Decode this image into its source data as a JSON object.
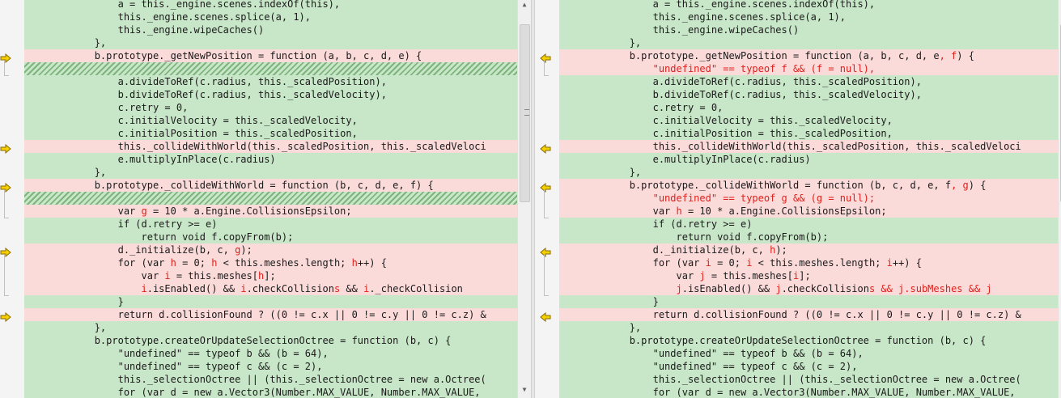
{
  "left": {
    "lines": [
      {
        "t": "same",
        "segs": [
          [
            "",
            "                a = this._engine.scenes.indexOf(this),"
          ]
        ]
      },
      {
        "t": "same",
        "segs": [
          [
            "",
            "                this._engine.scenes.splice(a, 1),"
          ]
        ]
      },
      {
        "t": "same",
        "segs": [
          [
            "",
            "                this._engine.wipeCaches()"
          ]
        ]
      },
      {
        "t": "same",
        "segs": [
          [
            "",
            "            },"
          ]
        ]
      },
      {
        "t": "diff",
        "segs": [
          [
            "",
            "            b.prototype._getNewPosition = function (a, b, c, d, e) {"
          ]
        ]
      },
      {
        "t": "pad",
        "segs": []
      },
      {
        "t": "same",
        "segs": [
          [
            "",
            "                a.divideToRef(c.radius, this._scaledPosition),"
          ]
        ]
      },
      {
        "t": "same",
        "segs": [
          [
            "",
            "                b.divideToRef(c.radius, this._scaledVelocity),"
          ]
        ]
      },
      {
        "t": "same",
        "segs": [
          [
            "",
            "                c.retry = 0,"
          ]
        ]
      },
      {
        "t": "same",
        "segs": [
          [
            "",
            "                c.initialVelocity = this._scaledVelocity,"
          ]
        ]
      },
      {
        "t": "same",
        "segs": [
          [
            "",
            "                c.initialPosition = this._scaledPosition,"
          ]
        ]
      },
      {
        "t": "diff",
        "segs": [
          [
            "",
            "                this._collideWithWorld(this._scaledPosition, this._scaledVeloci"
          ]
        ]
      },
      {
        "t": "same",
        "segs": [
          [
            "",
            "                e.multiplyInPlace(c.radius)"
          ]
        ]
      },
      {
        "t": "same",
        "segs": [
          [
            "",
            "            },"
          ]
        ]
      },
      {
        "t": "diff",
        "segs": [
          [
            "",
            "            b.prototype._collideWithWorld = function (b, c, d, e, f) {"
          ]
        ]
      },
      {
        "t": "pad",
        "segs": []
      },
      {
        "t": "diff",
        "segs": [
          [
            "",
            "                var "
          ],
          [
            "red",
            "g"
          ],
          [
            "",
            " = 10 * a.Engine.CollisionsEpsilon;"
          ]
        ]
      },
      {
        "t": "same",
        "segs": [
          [
            "",
            "                if (d.retry >= e)"
          ]
        ]
      },
      {
        "t": "same",
        "segs": [
          [
            "",
            "                    return void f.copyFrom(b);"
          ]
        ]
      },
      {
        "t": "diff",
        "segs": [
          [
            "",
            "                d._initialize(b, c, "
          ],
          [
            "red",
            "g"
          ],
          [
            "",
            ");"
          ]
        ]
      },
      {
        "t": "diff",
        "segs": [
          [
            "",
            "                for (var "
          ],
          [
            "red",
            "h"
          ],
          [
            "",
            " = 0; "
          ],
          [
            "red",
            "h"
          ],
          [
            "",
            " < this.meshes.length; "
          ],
          [
            "red",
            "h"
          ],
          [
            "",
            "++) {"
          ]
        ]
      },
      {
        "t": "diff",
        "segs": [
          [
            "",
            "                    var "
          ],
          [
            "red",
            "i"
          ],
          [
            "",
            " = this.meshes["
          ],
          [
            "red",
            "h"
          ],
          [
            "",
            "];"
          ]
        ]
      },
      {
        "t": "diff",
        "segs": [
          [
            "",
            "                    "
          ],
          [
            "red",
            "i"
          ],
          [
            "",
            ".isEnabled() && "
          ],
          [
            "red",
            "i"
          ],
          [
            "",
            ".checkCollision"
          ],
          [
            "red",
            "s"
          ],
          [
            "",
            " && "
          ],
          [
            "red",
            "i"
          ],
          [
            "",
            "._checkCollision"
          ]
        ]
      },
      {
        "t": "same",
        "segs": [
          [
            "",
            "                }"
          ]
        ]
      },
      {
        "t": "diff",
        "segs": [
          [
            "",
            "                return d.collisionFound ? ((0 != c.x || 0 != c.y || 0 != c.z) &"
          ]
        ]
      },
      {
        "t": "same",
        "segs": [
          [
            "",
            "            },"
          ]
        ]
      },
      {
        "t": "same",
        "segs": [
          [
            "",
            "            b.prototype.createOrUpdateSelectionOctree = function (b, c) {"
          ]
        ]
      },
      {
        "t": "same",
        "segs": [
          [
            "",
            "                \"undefined\" == typeof b && (b = 64),"
          ]
        ]
      },
      {
        "t": "same",
        "segs": [
          [
            "",
            "                \"undefined\" == typeof c && (c = 2),"
          ]
        ]
      },
      {
        "t": "same",
        "segs": [
          [
            "",
            "                this._selectionOctree || (this._selectionOctree = new a.Octree("
          ]
        ]
      },
      {
        "t": "same",
        "segs": [
          [
            "",
            "                for (var d = new a.Vector3(Number.MAX_VALUE, Number.MAX_VALUE,"
          ]
        ]
      }
    ]
  },
  "right": {
    "lines": [
      {
        "t": "same",
        "segs": [
          [
            "",
            "                a = this._engine.scenes.indexOf(this),"
          ]
        ]
      },
      {
        "t": "same",
        "segs": [
          [
            "",
            "                this._engine.scenes.splice(a, 1),"
          ]
        ]
      },
      {
        "t": "same",
        "segs": [
          [
            "",
            "                this._engine.wipeCaches()"
          ]
        ]
      },
      {
        "t": "same",
        "segs": [
          [
            "",
            "            },"
          ]
        ]
      },
      {
        "t": "diff",
        "segs": [
          [
            "",
            "            b.prototype._getNewPosition = function (a, b, c, d, e"
          ],
          [
            "red",
            ", f"
          ],
          [
            "",
            ") {"
          ]
        ]
      },
      {
        "t": "diff",
        "segs": [
          [
            "red",
            "                \"undefined\" == typeof f && (f = null),"
          ]
        ]
      },
      {
        "t": "same",
        "segs": [
          [
            "",
            "                a.divideToRef(c.radius, this._scaledPosition),"
          ]
        ]
      },
      {
        "t": "same",
        "segs": [
          [
            "",
            "                b.divideToRef(c.radius, this._scaledVelocity),"
          ]
        ]
      },
      {
        "t": "same",
        "segs": [
          [
            "",
            "                c.retry = 0,"
          ]
        ]
      },
      {
        "t": "same",
        "segs": [
          [
            "",
            "                c.initialVelocity = this._scaledVelocity,"
          ]
        ]
      },
      {
        "t": "same",
        "segs": [
          [
            "",
            "                c.initialPosition = this._scaledPosition,"
          ]
        ]
      },
      {
        "t": "diff",
        "segs": [
          [
            "",
            "                this._collideWithWorld(this._scaledPosition, this._scaledVeloci"
          ]
        ]
      },
      {
        "t": "same",
        "segs": [
          [
            "",
            "                e.multiplyInPlace(c.radius)"
          ]
        ]
      },
      {
        "t": "same",
        "segs": [
          [
            "",
            "            },"
          ]
        ]
      },
      {
        "t": "diff",
        "segs": [
          [
            "",
            "            b.prototype._collideWithWorld = function (b, c, d, e, f"
          ],
          [
            "red",
            ", g"
          ],
          [
            "",
            ") {"
          ]
        ]
      },
      {
        "t": "diff",
        "segs": [
          [
            "red",
            "                \"undefined\" == typeof g && (g = null);"
          ]
        ]
      },
      {
        "t": "diff",
        "segs": [
          [
            "",
            "                var "
          ],
          [
            "red",
            "h"
          ],
          [
            "",
            " = 10 * a.Engine.CollisionsEpsilon;"
          ]
        ]
      },
      {
        "t": "same",
        "segs": [
          [
            "",
            "                if (d.retry >= e)"
          ]
        ]
      },
      {
        "t": "same",
        "segs": [
          [
            "",
            "                    return void f.copyFrom(b);"
          ]
        ]
      },
      {
        "t": "diff",
        "segs": [
          [
            "",
            "                d._initialize(b, c, "
          ],
          [
            "red",
            "h"
          ],
          [
            "",
            ");"
          ]
        ]
      },
      {
        "t": "diff",
        "segs": [
          [
            "",
            "                for (var "
          ],
          [
            "red",
            "i"
          ],
          [
            "",
            " = 0; "
          ],
          [
            "red",
            "i"
          ],
          [
            "",
            " < this.meshes.length; "
          ],
          [
            "red",
            "i"
          ],
          [
            "",
            "++) {"
          ]
        ]
      },
      {
        "t": "diff",
        "segs": [
          [
            "",
            "                    var "
          ],
          [
            "red",
            "j"
          ],
          [
            "",
            " = this.meshes["
          ],
          [
            "red",
            "i"
          ],
          [
            "",
            "];"
          ]
        ]
      },
      {
        "t": "diff",
        "segs": [
          [
            "",
            "                    "
          ],
          [
            "red",
            "j"
          ],
          [
            "",
            ".isEnabled() && "
          ],
          [
            "red",
            "j"
          ],
          [
            "",
            ".checkCollision"
          ],
          [
            "red",
            "s && j.subMeshes && j"
          ]
        ]
      },
      {
        "t": "same",
        "segs": [
          [
            "",
            "                }"
          ]
        ]
      },
      {
        "t": "diff",
        "segs": [
          [
            "",
            "                return d.collisionFound ? ((0 != c.x || 0 != c.y || 0 != c.z) &"
          ]
        ]
      },
      {
        "t": "same",
        "segs": [
          [
            "",
            "            },"
          ]
        ]
      },
      {
        "t": "same",
        "segs": [
          [
            "",
            "            b.prototype.createOrUpdateSelectionOctree = function (b, c) {"
          ]
        ]
      },
      {
        "t": "same",
        "segs": [
          [
            "",
            "                \"undefined\" == typeof b && (b = 64),"
          ]
        ]
      },
      {
        "t": "same",
        "segs": [
          [
            "",
            "                \"undefined\" == typeof c && (c = 2),"
          ]
        ]
      },
      {
        "t": "same",
        "segs": [
          [
            "",
            "                this._selectionOctree || (this._selectionOctree = new a.Octree("
          ]
        ]
      },
      {
        "t": "same",
        "segs": [
          [
            "",
            "                for (var d = new a.Vector3(Number.MAX_VALUE, Number.MAX_VALUE,"
          ]
        ]
      }
    ]
  },
  "colors": {
    "same_bg": "#c8e6c8",
    "diff_bg": "#fbdada",
    "changed_text": "#e0201a",
    "arrow_fill": "#f5d000"
  },
  "icons": {
    "change_marker": "yellow-arrow-icon",
    "scroll_up": "scroll-up-icon",
    "scroll_down": "scroll-down-icon"
  }
}
